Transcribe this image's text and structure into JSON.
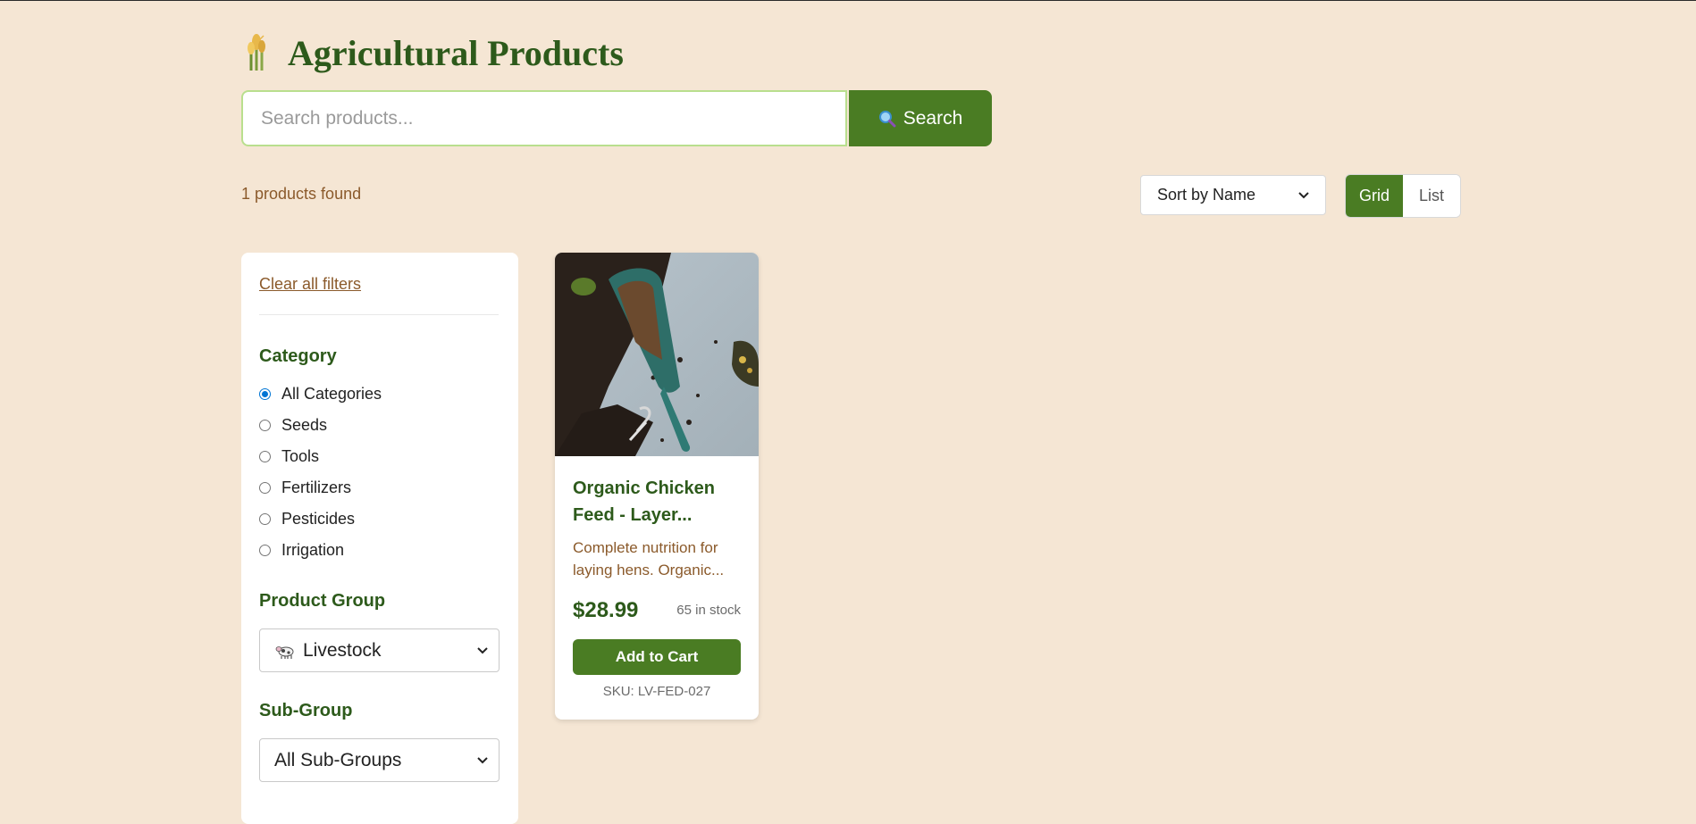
{
  "header": {
    "title": "Agricultural Products",
    "logo_icon": "wheat-icon"
  },
  "search": {
    "placeholder": "Search products...",
    "value": "",
    "button_label": "Search",
    "button_icon": "magnifier-icon"
  },
  "results": {
    "count_text": "1 products found"
  },
  "sort": {
    "selected": "Sort by Name"
  },
  "view_toggle": {
    "options": [
      "Grid",
      "List"
    ],
    "active": "Grid"
  },
  "filters": {
    "clear_label": "Clear all filters",
    "category": {
      "heading": "Category",
      "options": [
        "All Categories",
        "Seeds",
        "Tools",
        "Fertilizers",
        "Pesticides",
        "Irrigation"
      ],
      "selected": "All Categories"
    },
    "product_group": {
      "heading": "Product Group",
      "selected": "Livestock",
      "icon": "cow-icon"
    },
    "sub_group": {
      "heading": "Sub-Group",
      "selected": "All Sub-Groups"
    }
  },
  "products": [
    {
      "name": "Organic Chicken Feed - Layer...",
      "description": "Complete nutrition for laying hens. Organic...",
      "price": "$28.99",
      "stock": "65 in stock",
      "button_label": "Add to Cart",
      "sku": "SKU: LV-FED-027",
      "image": "garden-trowel-soil-photo"
    }
  ],
  "colors": {
    "background": "#f5e6d4",
    "primary": "#4a7c23",
    "heading": "#2d5a1b",
    "accent_text": "#8b5a2b"
  }
}
